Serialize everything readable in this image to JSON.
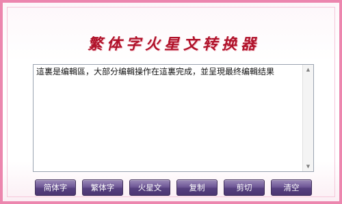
{
  "app": {
    "title": "繁体字火星文转换器"
  },
  "editor": {
    "value": "這裏是编輯區，大部分编輯操作在這裏完成，並呈現最终编輯结果"
  },
  "toolbar": {
    "buttons": [
      {
        "label": "简体字"
      },
      {
        "label": "繁体字"
      },
      {
        "label": "火星文"
      },
      {
        "label": "复制"
      },
      {
        "label": "剪切"
      },
      {
        "label": "清空"
      }
    ]
  },
  "colors": {
    "border_pink": "#ec86ae",
    "title_red": "#b0122a",
    "button_purple": "#5c4585"
  }
}
